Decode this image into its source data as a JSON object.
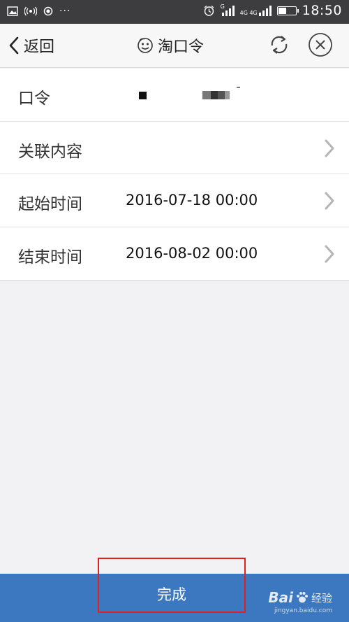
{
  "status_bar": {
    "time": "18:50",
    "sim1_label": "G",
    "sim2_label": "4G 4G",
    "battery_level": 0.45,
    "icons": [
      "image-icon",
      "hotspot-icon",
      "record-icon",
      "more-icon",
      "alarm-icon",
      "signal-icon",
      "battery-icon"
    ]
  },
  "nav": {
    "back_label": "返回",
    "title": "淘口令",
    "icons": [
      "chevron-left-icon",
      "taobao-face-icon",
      "refresh-icon",
      "close-icon"
    ]
  },
  "rows": [
    {
      "label": "口令",
      "value": ""
    },
    {
      "label": "关联内容",
      "value": ""
    },
    {
      "label": "起始时间",
      "value": "2016-07-18 00:00"
    },
    {
      "label": "结束时间",
      "value": "2016-08-02 00:00"
    }
  ],
  "footer": {
    "done_label": "完成",
    "watermark_brand": "Bai",
    "watermark_cn": "经验",
    "watermark_url": "jingyan.baidu.com"
  },
  "colors": {
    "status_bar": "#3d3d3f",
    "footer": "#3c78c0",
    "highlight_border": "#e02020",
    "background": "#f2f2f4"
  }
}
